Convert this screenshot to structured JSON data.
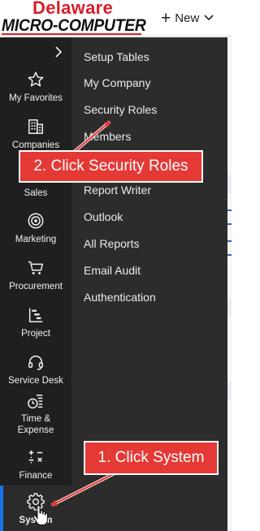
{
  "header": {
    "logo_top": "Delaware",
    "logo_bottom": "MICRO-COMPUTER",
    "new_label": "New"
  },
  "leftnav": {
    "items": [
      {
        "label": "My Favorites",
        "icon": "star-icon"
      },
      {
        "label": "Companies",
        "icon": "building-icon"
      },
      {
        "label": "Sales",
        "icon": "sales-icon"
      },
      {
        "label": "Marketing",
        "icon": "target-icon"
      },
      {
        "label": "Procurement",
        "icon": "cart-icon"
      },
      {
        "label": "Project",
        "icon": "project-icon"
      },
      {
        "label": "Service Desk",
        "icon": "headset-icon"
      },
      {
        "label": "Time &",
        "label2": "Expense",
        "icon": "time-expense-icon"
      },
      {
        "label": "Finance",
        "icon": "calculator-icon"
      },
      {
        "label": "System",
        "icon": "gear-icon",
        "active": true
      }
    ]
  },
  "flyout": {
    "items": [
      "Setup Tables",
      "My Company",
      "Security Roles",
      "Members",
      "Report Writer",
      "Outlook",
      "All Reports",
      "Email Audit",
      "Authentication"
    ]
  },
  "callouts": {
    "step1": "1. Click System",
    "step2": "2. Click Security Roles"
  },
  "colors": {
    "callout": "#e53935",
    "nav_bg": "#1f1f1f",
    "flyout_bg": "#2c2c2c",
    "active_indicator": "#1a73e8",
    "logo_red": "#d81e28"
  }
}
